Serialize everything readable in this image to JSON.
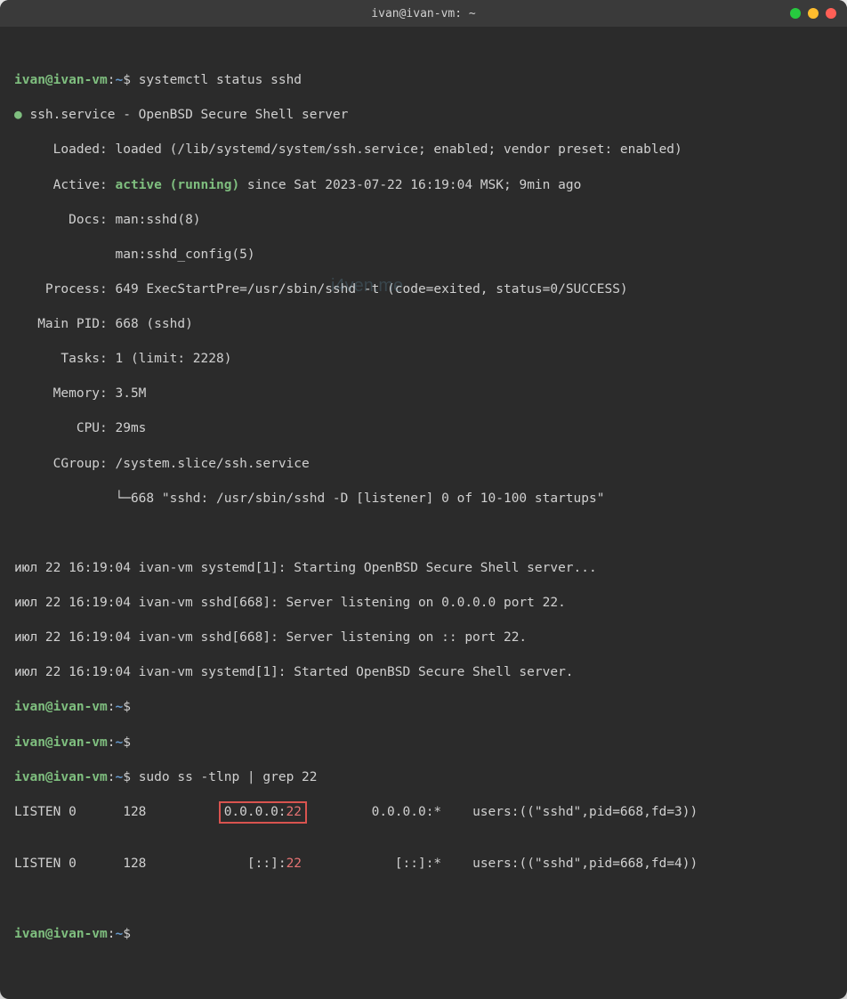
{
  "window": {
    "title": "ivan@ivan-vm: ~"
  },
  "prompt": {
    "user_host": "ivan@ivan-vm",
    "path": "~",
    "symbol": "$"
  },
  "commands": {
    "cmd1": "systemctl status sshd",
    "cmd2": "sudo ss -tlnp | grep 22"
  },
  "service": {
    "name_line": "ssh.service - OpenBSD Secure Shell server",
    "loaded_label": "     Loaded:",
    "loaded_value": " loaded (/lib/systemd/system/ssh.service; enabled; vendor preset: enabled)",
    "active_label": "     Active: ",
    "active_status": "active (running)",
    "active_since": " since Sat 2023-07-22 16:19:04 MSK; 9min ago",
    "docs_label": "       Docs:",
    "docs1": " man:sshd(8)",
    "docs2": "             man:sshd_config(5)",
    "process_label": "    Process:",
    "process_value": " 649 ExecStartPre=/usr/sbin/sshd -t (code=exited, status=0/SUCCESS)",
    "mainpid_label": "   Main PID:",
    "mainpid_value": " 668 (sshd)",
    "tasks_label": "      Tasks:",
    "tasks_value": " 1 (limit: 2228)",
    "memory_label": "     Memory:",
    "memory_value": " 3.5M",
    "cpu_label": "        CPU:",
    "cpu_value": " 29ms",
    "cgroup_label": "     CGroup:",
    "cgroup_value": " /system.slice/ssh.service",
    "cgroup_tree": "             └─668 \"sshd: /usr/sbin/sshd -D [listener] 0 of 10-100 startups\""
  },
  "logs": {
    "l1": "июл 22 16:19:04 ivan-vm systemd[1]: Starting OpenBSD Secure Shell server...",
    "l2": "июл 22 16:19:04 ivan-vm sshd[668]: Server listening on 0.0.0.0 port 22.",
    "l3": "июл 22 16:19:04 ivan-vm sshd[668]: Server listening on :: port 22.",
    "l4": "июл 22 16:19:04 ivan-vm systemd[1]: Started OpenBSD Secure Shell server."
  },
  "ss_output": {
    "row1": {
      "state": "LISTEN 0      128          ",
      "local_ip": "0.0.0.0:",
      "local_port": "22",
      "spacer": "         0.0.0.0:*    users:((\"sshd\",pid=668,fd=3))"
    },
    "blank": "",
    "row2": {
      "state": "LISTEN 0      128             ",
      "local_ip": "[::]:",
      "local_port": "22",
      "spacer": "            [::]:*    users:((\"sshd\",pid=668,fd=4))"
    }
  },
  "watermark": "i4ven.me"
}
